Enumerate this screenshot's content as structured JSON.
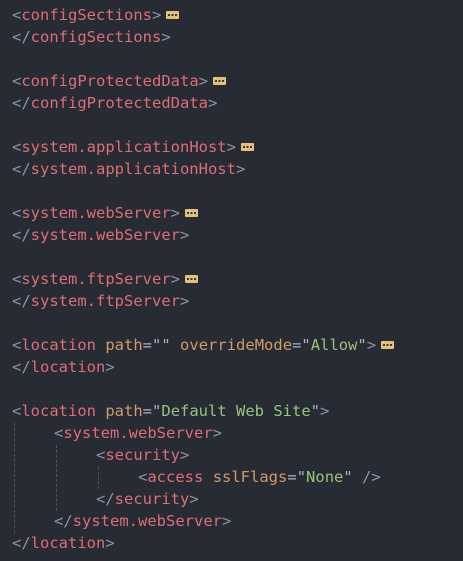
{
  "editor": {
    "lines": {
      "l1": {
        "open": "<",
        "tag": "configSections",
        "close": ">",
        "folded": true
      },
      "l2": {
        "open": "</",
        "tag": "configSections",
        "close": ">"
      },
      "l4": {
        "open": "<",
        "tag": "configProtectedData",
        "close": ">",
        "folded": true
      },
      "l5": {
        "open": "</",
        "tag": "configProtectedData",
        "close": ">"
      },
      "l7": {
        "open": "<",
        "tag": "system.applicationHost",
        "close": ">",
        "folded": true
      },
      "l8": {
        "open": "</",
        "tag": "system.applicationHost",
        "close": ">"
      },
      "l10": {
        "open": "<",
        "tag": "system.webServer",
        "close": ">",
        "folded": true
      },
      "l11": {
        "open": "</",
        "tag": "system.webServer",
        "close": ">"
      },
      "l13": {
        "open": "<",
        "tag": "system.ftpServer",
        "close": ">",
        "folded": true
      },
      "l14": {
        "open": "</",
        "tag": "system.ftpServer",
        "close": ">"
      },
      "l16": {
        "open": "<",
        "tag": "location",
        "attr1": "path",
        "eq": "=",
        "q": "\"",
        "val1": "",
        "attr2": "overrideMode",
        "val2": "Allow",
        "close": ">",
        "folded": true
      },
      "l17": {
        "open": "</",
        "tag": "location",
        "close": ">"
      },
      "l19": {
        "open": "<",
        "tag": "location",
        "attr1": "path",
        "eq": "=",
        "q": "\"",
        "val1": "Default Web Site",
        "close": ">"
      },
      "l20": {
        "open": "<",
        "tag": "system.webServer",
        "close": ">"
      },
      "l21": {
        "open": "<",
        "tag": "security",
        "close": ">"
      },
      "l22": {
        "open": "<",
        "tag": "access",
        "attr1": "sslFlags",
        "eq": "=",
        "q": "\"",
        "val1": "None",
        "close": "/>"
      },
      "l23": {
        "open": "</",
        "tag": "security",
        "close": ">"
      },
      "l24": {
        "open": "</",
        "tag": "system.webServer",
        "close": ">"
      },
      "l25": {
        "open": "</",
        "tag": "location",
        "close": ">"
      }
    },
    "colors": {
      "background": "#272c34",
      "tag": "#e06c75",
      "attribute": "#d19a66",
      "string": "#98c379",
      "bracket": "#8b95a5",
      "fold_marker": "#e5c07b"
    }
  }
}
